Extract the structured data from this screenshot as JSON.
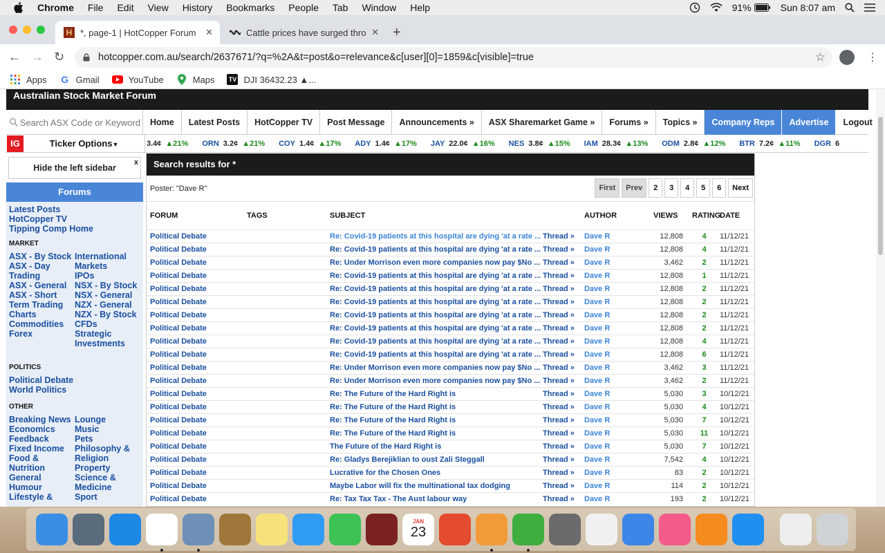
{
  "menubar": {
    "app": "Chrome",
    "items": [
      "File",
      "Edit",
      "View",
      "History",
      "Bookmarks",
      "People",
      "Tab",
      "Window",
      "Help"
    ],
    "battery": "91%",
    "clock": "Sun 8:07 am"
  },
  "tabs": [
    {
      "favicon": "H",
      "title": "*, page-1 | HotCopper Forum",
      "active": true
    },
    {
      "favicon": "abc",
      "title": "Cattle prices have surged thro",
      "active": false
    }
  ],
  "address": {
    "url": "hotcopper.com.au/search/2637671/?q=%2A&t=post&o=relevance&c[user][0]=1859&c[visible]=true"
  },
  "bookmarks": [
    {
      "label": "Apps",
      "icon": "apps-grid-icon"
    },
    {
      "label": "Gmail",
      "icon": "google-icon"
    },
    {
      "label": "YouTube",
      "icon": "youtube-icon"
    },
    {
      "label": "Maps",
      "icon": "maps-pin-icon"
    },
    {
      "label": "DJI 36432.23 ▲...",
      "icon": "tradingview-icon"
    }
  ],
  "site": {
    "header": "Australian Stock Market Forum",
    "search_placeholder": "Search ASX Code or Keyword",
    "nav": [
      "Home",
      "Latest Posts",
      "HotCopper TV",
      "Post Message",
      "Announcements »",
      "ASX Sharemarket Game »",
      "Forums »",
      "Topics »"
    ],
    "nav_right": [
      "Company Reps",
      "Advertise",
      "Logout"
    ],
    "ticker_logo": "IG",
    "ticker_options": "Ticker Options",
    "tickers": [
      {
        "code": "",
        "price": "3.4¢",
        "change": "▲21%"
      },
      {
        "code": "ORN",
        "price": "3.2¢",
        "change": "▲21%"
      },
      {
        "code": "COY",
        "price": "1.4¢",
        "change": "▲17%"
      },
      {
        "code": "ADY",
        "price": "1.4¢",
        "change": "▲17%"
      },
      {
        "code": "JAY",
        "price": "22.0¢",
        "change": "▲16%"
      },
      {
        "code": "NES",
        "price": "3.8¢",
        "change": "▲15%"
      },
      {
        "code": "IAM",
        "price": "28.3¢",
        "change": "▲13%"
      },
      {
        "code": "ODM",
        "price": "2.8¢",
        "change": "▲12%"
      },
      {
        "code": "BTR",
        "price": "7.2¢",
        "change": "▲11%"
      },
      {
        "code": "DGR",
        "price": "6",
        "change": ""
      }
    ]
  },
  "sidebar": {
    "hide_label": "Hide the left sidebar",
    "close": "x",
    "forums_title": "Forums",
    "top_links": [
      "Latest Posts",
      "HotCopper TV",
      "Tipping Comp Home"
    ],
    "market_head": "MARKET",
    "market_left": [
      "ASX - By Stock",
      "ASX - Day",
      "Trading",
      "ASX - General",
      "ASX - Short",
      "Term Trading",
      "Charts",
      "Commodities",
      "Forex"
    ],
    "market_right": [
      "International",
      "Markets",
      "IPOs",
      "NSX - By Stock",
      "NSX - General",
      "NZX - General",
      "NZX - By Stock",
      "CFDs",
      "Strategic",
      "Investments"
    ],
    "politics_head": "POLITICS",
    "politics": [
      "Political Debate",
      "World Politics"
    ],
    "other_head": "OTHER",
    "other_left": [
      "Breaking News",
      "Economics",
      "Feedback",
      "Fixed Income",
      "Food &",
      "Nutrition",
      "General",
      "Humour",
      "Lifestyle &"
    ],
    "other_right": [
      "Lounge",
      "Music",
      "Pets",
      "Philosophy &",
      "Religion",
      "Property",
      "Science &",
      "Medicine",
      "Sport"
    ]
  },
  "results": {
    "heading": "Search results for *",
    "poster": "Poster: \"Dave R\"",
    "pager": [
      "First",
      "Prev",
      "2",
      "3",
      "4",
      "5",
      "6",
      "Next"
    ],
    "columns": [
      "FORUM",
      "TAGS",
      "SUBJECT",
      "",
      "AUTHOR",
      "VIEWS",
      "RATING",
      "DATE"
    ],
    "rows": [
      {
        "forum": "Political Debate",
        "subject": "Re: Covid-19 patients at this hospital are dying 'at a rate ...",
        "light": true,
        "thread": "Thread »",
        "author": "Dave R",
        "views": "12,808",
        "rating": "4",
        "date": "11/12/21"
      },
      {
        "forum": "Political Debate",
        "subject": "Re: Covid-19 patients at this hospital are dying 'at a rate ...",
        "light": false,
        "thread": "Thread »",
        "author": "Dave R",
        "views": "12,808",
        "rating": "4",
        "date": "11/12/21"
      },
      {
        "forum": "Political Debate",
        "subject": "Re: Under Morrison even more companies now pay $No ...",
        "light": false,
        "thread": "Thread »",
        "author": "Dave R",
        "views": "3,462",
        "rating": "2",
        "date": "11/12/21"
      },
      {
        "forum": "Political Debate",
        "subject": "Re: Covid-19 patients at this hospital are dying 'at a rate ...",
        "light": false,
        "thread": "Thread »",
        "author": "Dave R",
        "views": "12,808",
        "rating": "1",
        "date": "11/12/21"
      },
      {
        "forum": "Political Debate",
        "subject": "Re: Covid-19 patients at this hospital are dying 'at a rate ...",
        "light": false,
        "thread": "Thread »",
        "author": "Dave R",
        "views": "12,808",
        "rating": "2",
        "date": "11/12/21"
      },
      {
        "forum": "Political Debate",
        "subject": "Re: Covid-19 patients at this hospital are dying 'at a rate ...",
        "light": false,
        "thread": "Thread »",
        "author": "Dave R",
        "views": "12,808",
        "rating": "2",
        "date": "11/12/21"
      },
      {
        "forum": "Political Debate",
        "subject": "Re: Covid-19 patients at this hospital are dying 'at a rate ...",
        "light": false,
        "thread": "Thread »",
        "author": "Dave R",
        "views": "12,808",
        "rating": "2",
        "date": "11/12/21"
      },
      {
        "forum": "Political Debate",
        "subject": "Re: Covid-19 patients at this hospital are dying 'at a rate ...",
        "light": false,
        "thread": "Thread »",
        "author": "Dave R",
        "views": "12,808",
        "rating": "2",
        "date": "11/12/21"
      },
      {
        "forum": "Political Debate",
        "subject": "Re: Covid-19 patients at this hospital are dying 'at a rate ...",
        "light": false,
        "thread": "Thread »",
        "author": "Dave R",
        "views": "12,808",
        "rating": "4",
        "date": "11/12/21"
      },
      {
        "forum": "Political Debate",
        "subject": "Re: Covid-19 patients at this hospital are dying 'at a rate ...",
        "light": false,
        "thread": "Thread »",
        "author": "Dave R",
        "views": "12,808",
        "rating": "6",
        "date": "11/12/21"
      },
      {
        "forum": "Political Debate",
        "subject": "Re: Under Morrison even more companies now pay $No ...",
        "light": false,
        "thread": "Thread »",
        "author": "Dave R",
        "views": "3,462",
        "rating": "3",
        "date": "11/12/21"
      },
      {
        "forum": "Political Debate",
        "subject": "Re: Under Morrison even more companies now pay $No ...",
        "light": false,
        "thread": "Thread »",
        "author": "Dave R",
        "views": "3,462",
        "rating": "2",
        "date": "11/12/21"
      },
      {
        "forum": "Political Debate",
        "subject": "Re: The Future of the Hard Right is",
        "light": false,
        "thread": "Thread »",
        "author": "Dave R",
        "views": "5,030",
        "rating": "3",
        "date": "10/12/21"
      },
      {
        "forum": "Political Debate",
        "subject": "Re: The Future of the Hard Right is",
        "light": false,
        "thread": "Thread »",
        "author": "Dave R",
        "views": "5,030",
        "rating": "4",
        "date": "10/12/21"
      },
      {
        "forum": "Political Debate",
        "subject": "Re: The Future of the Hard Right is",
        "light": false,
        "thread": "Thread »",
        "author": "Dave R",
        "views": "5,030",
        "rating": "7",
        "date": "10/12/21"
      },
      {
        "forum": "Political Debate",
        "subject": "Re: The Future of the Hard Right is",
        "light": false,
        "thread": "Thread »",
        "author": "Dave R",
        "views": "5,030",
        "rating": "11",
        "date": "10/12/21"
      },
      {
        "forum": "Political Debate",
        "subject": "The Future of the Hard Right is",
        "light": false,
        "thread": "Thread »",
        "author": "Dave R",
        "views": "5,030",
        "rating": "7",
        "date": "10/12/21"
      },
      {
        "forum": "Political Debate",
        "subject": "Re: Gladys Berejiklian to oust Zali Steggall",
        "light": false,
        "thread": "Thread »",
        "author": "Dave R",
        "views": "7,542",
        "rating": "4",
        "date": "10/12/21"
      },
      {
        "forum": "Political Debate",
        "subject": "Lucrative for the Chosen Ones",
        "light": false,
        "thread": "Thread »",
        "author": "Dave R",
        "views": "83",
        "rating": "2",
        "date": "10/12/21"
      },
      {
        "forum": "Political Debate",
        "subject": "Maybe Labor will fix the multinational tax dodging",
        "light": false,
        "thread": "Thread »",
        "author": "Dave R",
        "views": "114",
        "rating": "2",
        "date": "10/12/21"
      },
      {
        "forum": "Political Debate",
        "subject": "Re: Tax Tax Tax - The Aust labour way",
        "light": false,
        "thread": "Thread »",
        "author": "Dave R",
        "views": "193",
        "rating": "2",
        "date": "10/12/21"
      }
    ]
  },
  "dock": {
    "calendar_month": "JAN",
    "calendar_day": "23",
    "apps": [
      "finder-icon",
      "launchpad-icon",
      "safari-icon",
      "chrome-icon",
      "preview-icon",
      "contacts-icon",
      "notes-icon",
      "messages-icon",
      "facetime-icon",
      "photo-booth-icon",
      "calendar-icon",
      "keynote-alt-icon",
      "pages-icon",
      "numbers-icon",
      "system-preferences-icon",
      "photos-icon",
      "keynote-icon",
      "itunes-icon",
      "books-icon",
      "app-store-icon",
      "downloads-stack-icon",
      "trash-icon"
    ]
  },
  "colors": {
    "accent": "#4a86d8",
    "link": "#1a4fa0",
    "positive": "#1a8a1a",
    "header_dark": "#1b1b1b",
    "ig_red": "#e31b23"
  }
}
